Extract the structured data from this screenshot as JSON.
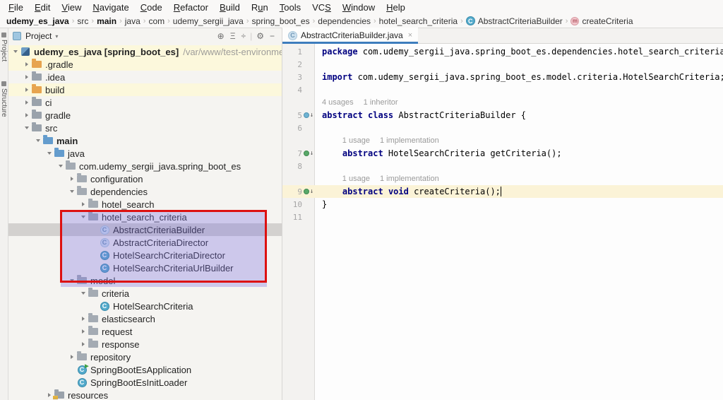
{
  "menu": {
    "items": [
      {
        "label": "File",
        "m": 0
      },
      {
        "label": "Edit",
        "m": 0
      },
      {
        "label": "View",
        "m": 0
      },
      {
        "label": "Navigate",
        "m": 0
      },
      {
        "label": "Code",
        "m": 0
      },
      {
        "label": "Refactor",
        "m": 0
      },
      {
        "label": "Build",
        "m": 0
      },
      {
        "label": "Run",
        "m": 1
      },
      {
        "label": "Tools",
        "m": 0
      },
      {
        "label": "VCS",
        "m": 2
      },
      {
        "label": "Window",
        "m": 0
      },
      {
        "label": "Help",
        "m": 0
      }
    ]
  },
  "breadcrumbs": {
    "separator": "›",
    "items": [
      {
        "label": "udemy_es_java",
        "bold": true
      },
      {
        "label": "src"
      },
      {
        "label": "main",
        "bold": true
      },
      {
        "label": "java"
      },
      {
        "label": "com"
      },
      {
        "label": "udemy_sergii_java"
      },
      {
        "label": "spring_boot_es"
      },
      {
        "label": "dependencies"
      },
      {
        "label": "hotel_search_criteria"
      },
      {
        "label": "AbstractCriteriaBuilder",
        "icon": "class"
      },
      {
        "label": "createCriteria",
        "icon": "method"
      }
    ]
  },
  "stripe": {
    "items": [
      {
        "label": "Project"
      },
      {
        "label": "Structure"
      }
    ]
  },
  "project": {
    "header": {
      "title": "Project",
      "caret": "▾",
      "icons": [
        {
          "name": "locate-icon",
          "glyph": "⊕"
        },
        {
          "name": "expand-all-icon",
          "glyph": "Ξ"
        },
        {
          "name": "collapse-all-icon",
          "glyph": "÷"
        },
        {
          "name": "separator",
          "glyph": "|"
        },
        {
          "name": "settings-icon",
          "glyph": "⚙"
        },
        {
          "name": "hide-icon",
          "glyph": "−"
        }
      ]
    },
    "tree": [
      {
        "d": 0,
        "chev": "o",
        "icon": "project",
        "label": "udemy_es_java [spring_boot_es]",
        "bold": true,
        "path": "/var/www/test-environments",
        "bg": "y"
      },
      {
        "d": 1,
        "chev": "c",
        "icon": "folder-orange",
        "label": ".gradle",
        "bg": "y"
      },
      {
        "d": 1,
        "chev": "c",
        "icon": "folder",
        "label": ".idea"
      },
      {
        "d": 1,
        "chev": "c",
        "icon": "folder-orange",
        "label": "build",
        "bg": "y"
      },
      {
        "d": 1,
        "chev": "c",
        "icon": "folder",
        "label": "ci"
      },
      {
        "d": 1,
        "chev": "c",
        "icon": "folder",
        "label": "gradle"
      },
      {
        "d": 1,
        "chev": "o",
        "icon": "folder",
        "label": "src"
      },
      {
        "d": 2,
        "chev": "o",
        "icon": "folder-src",
        "label": "main",
        "bold": true
      },
      {
        "d": 3,
        "chev": "o",
        "icon": "folder-blue",
        "label": "java"
      },
      {
        "d": 4,
        "chev": "o",
        "icon": "pkg",
        "label": "com.udemy_sergii_java.spring_boot_es"
      },
      {
        "d": 5,
        "chev": "c",
        "icon": "pkg",
        "label": "configuration"
      },
      {
        "d": 5,
        "chev": "o",
        "icon": "pkg",
        "label": "dependencies"
      },
      {
        "d": 6,
        "chev": "c",
        "icon": "pkg",
        "label": "hotel_search"
      },
      {
        "d": 6,
        "chev": "o",
        "icon": "pkg",
        "label": "hotel_search_criteria"
      },
      {
        "d": 7,
        "chev": "n",
        "icon": "class-abstract",
        "label": "AbstractCriteriaBuilder",
        "sel": true
      },
      {
        "d": 7,
        "chev": "n",
        "icon": "class-abstract",
        "label": "AbstractCriteriaDirector"
      },
      {
        "d": 7,
        "chev": "n",
        "icon": "class",
        "label": "HotelSearchCriteriaDirector"
      },
      {
        "d": 7,
        "chev": "n",
        "icon": "class",
        "label": "HotelSearchCriteriaUrlBuilder"
      },
      {
        "d": 5,
        "chev": "o",
        "icon": "pkg",
        "label": "model"
      },
      {
        "d": 6,
        "chev": "o",
        "icon": "pkg",
        "label": "criteria"
      },
      {
        "d": 7,
        "chev": "n",
        "icon": "class",
        "label": "HotelSearchCriteria"
      },
      {
        "d": 6,
        "chev": "c",
        "icon": "pkg",
        "label": "elasticsearch"
      },
      {
        "d": 6,
        "chev": "c",
        "icon": "pkg",
        "label": "request"
      },
      {
        "d": 6,
        "chev": "c",
        "icon": "pkg",
        "label": "response"
      },
      {
        "d": 5,
        "chev": "c",
        "icon": "pkg",
        "label": "repository"
      },
      {
        "d": 5,
        "chev": "n",
        "icon": "class-run",
        "label": "SpringBootEsApplication"
      },
      {
        "d": 5,
        "chev": "n",
        "icon": "class",
        "label": "SpringBootEsInitLoader"
      },
      {
        "d": 3,
        "chev": "c",
        "icon": "folder-res",
        "label": "resources"
      }
    ]
  },
  "annotation": {
    "highlight_border_color": "#dd1111",
    "highlight_fill_color": "rgba(120,110,225,0.32)"
  },
  "editor": {
    "tab": {
      "label": "AbstractCriteriaBuilder.java",
      "close": "×"
    },
    "lines": [
      {
        "n": "1",
        "segs": [
          {
            "t": "k",
            "s": "package"
          },
          {
            "t": "p",
            "s": " com.udemy_sergii_java.spring_boot_es.dependencies.hotel_search_criteria;"
          }
        ]
      },
      {
        "n": "2",
        "segs": []
      },
      {
        "n": "3",
        "segs": [
          {
            "t": "k",
            "s": "import"
          },
          {
            "t": "p",
            "s": " com.udemy_sergii_java.spring_boot_es.model.criteria.HotelSearchCriteria;"
          }
        ]
      },
      {
        "n": "4",
        "segs": []
      },
      {
        "inlay": [
          "4 usages",
          "1 inheritor"
        ],
        "ind": 0
      },
      {
        "n": "5",
        "g": "blue",
        "segs": [
          {
            "t": "k",
            "s": "abstract"
          },
          {
            "t": "p",
            "s": " "
          },
          {
            "t": "k",
            "s": "class"
          },
          {
            "t": "p",
            "s": " AbstractCriteriaBuilder {"
          }
        ]
      },
      {
        "n": "6",
        "segs": []
      },
      {
        "inlay": [
          "1 usage",
          "1 implementation"
        ],
        "ind": 4
      },
      {
        "n": "7",
        "g": "green",
        "segs": [
          {
            "t": "p",
            "s": "    "
          },
          {
            "t": "k",
            "s": "abstract"
          },
          {
            "t": "p",
            "s": " HotelSearchCriteria getCriteria();"
          }
        ]
      },
      {
        "n": "8",
        "segs": []
      },
      {
        "inlay": [
          "1 usage",
          "1 implementation"
        ],
        "ind": 4
      },
      {
        "n": "9",
        "g": "green",
        "hl": true,
        "caret": true,
        "segs": [
          {
            "t": "p",
            "s": "    "
          },
          {
            "t": "k",
            "s": "abstract"
          },
          {
            "t": "p",
            "s": " "
          },
          {
            "t": "k",
            "s": "void"
          },
          {
            "t": "p",
            "s": " createCriteria();"
          }
        ]
      },
      {
        "n": "10",
        "segs": [
          {
            "t": "p",
            "s": "}"
          }
        ]
      },
      {
        "n": "11",
        "segs": []
      }
    ]
  }
}
